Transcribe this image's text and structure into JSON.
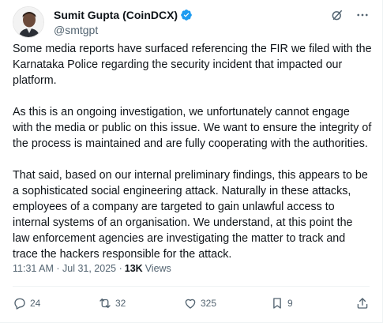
{
  "author": {
    "display_name": "Sumit Gupta (CoinDCX)",
    "handle": "@smtgpt",
    "verified_icon": "verified-badge-icon"
  },
  "tweet": {
    "paragraphs": [
      "Some media reports have surfaced referencing the FIR we filed with the Karnataka Police regarding the security incident that impacted our platform.",
      "As this is an ongoing investigation, we unfortunately cannot engage with the media or public on this issue. We want to ensure the integrity of the process is maintained and are fully cooperating with the authorities.",
      "That said, based on our internal preliminary findings, this appears to be a sophisticated social engineering attack. Naturally in these attacks, employees of a company are targeted to gain unlawful access to internal systems of an organisation. We understand, at this point the law enforcement agencies are investigating the matter to track and trace the hackers responsible for the attack."
    ],
    "timestamp": "11:31 AM · Jul 31, 2025 · ",
    "views_count": "13K",
    "views_label": "Views"
  },
  "actions": {
    "replies": "24",
    "reposts": "32",
    "likes": "325",
    "bookmarks": "9"
  },
  "colors": {
    "text": "#0f1419",
    "secondary": "#536471",
    "verified": "#1d9bf0"
  }
}
